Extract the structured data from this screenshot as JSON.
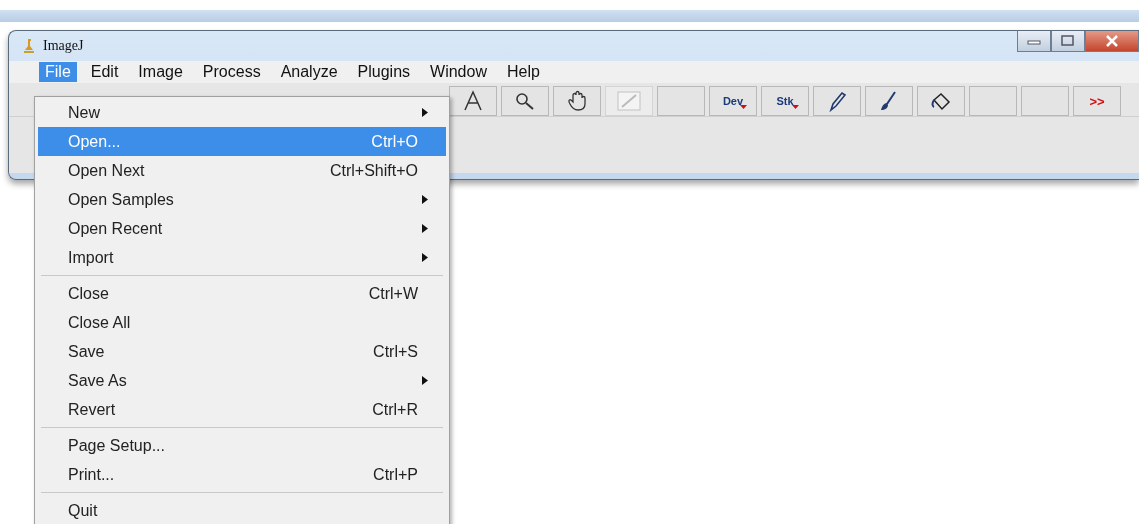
{
  "window": {
    "title": "ImageJ"
  },
  "menubar": [
    {
      "label": "File",
      "selected": true
    },
    {
      "label": "Edit",
      "selected": false
    },
    {
      "label": "Image",
      "selected": false
    },
    {
      "label": "Process",
      "selected": false
    },
    {
      "label": "Analyze",
      "selected": false
    },
    {
      "label": "Plugins",
      "selected": false
    },
    {
      "label": "Window",
      "selected": false
    },
    {
      "label": "Help",
      "selected": false
    }
  ],
  "toolbar": [
    {
      "kind": "text-tool",
      "disabled": false
    },
    {
      "kind": "magnifier",
      "disabled": false
    },
    {
      "kind": "hand",
      "disabled": false
    },
    {
      "kind": "arrow",
      "disabled": true
    },
    {
      "kind": "blank",
      "disabled": false
    },
    {
      "kind": "label",
      "label": "Dev",
      "dropdown": true,
      "disabled": false
    },
    {
      "kind": "label",
      "label": "Stk",
      "dropdown": true,
      "disabled": false
    },
    {
      "kind": "pencil",
      "disabled": false
    },
    {
      "kind": "brush",
      "disabled": false
    },
    {
      "kind": "fill",
      "disabled": false
    },
    {
      "kind": "blank",
      "disabled": false
    },
    {
      "kind": "blank",
      "disabled": false
    },
    {
      "kind": "more",
      "label": ">>",
      "disabled": false
    }
  ],
  "file_menu": [
    {
      "kind": "item",
      "label": "New",
      "submenu": true,
      "selected": false
    },
    {
      "kind": "item",
      "label": "Open...",
      "shortcut": "Ctrl+O",
      "selected": true
    },
    {
      "kind": "item",
      "label": "Open Next",
      "shortcut": "Ctrl+Shift+O",
      "selected": false
    },
    {
      "kind": "item",
      "label": "Open Samples",
      "submenu": true,
      "selected": false
    },
    {
      "kind": "item",
      "label": "Open Recent",
      "submenu": true,
      "selected": false
    },
    {
      "kind": "item",
      "label": "Import",
      "submenu": true,
      "selected": false
    },
    {
      "kind": "separator"
    },
    {
      "kind": "item",
      "label": "Close",
      "shortcut": "Ctrl+W",
      "selected": false
    },
    {
      "kind": "item",
      "label": "Close All",
      "selected": false
    },
    {
      "kind": "item",
      "label": "Save",
      "shortcut": "Ctrl+S",
      "selected": false
    },
    {
      "kind": "item",
      "label": "Save As",
      "submenu": true,
      "selected": false
    },
    {
      "kind": "item",
      "label": "Revert",
      "shortcut": "Ctrl+R",
      "selected": false
    },
    {
      "kind": "separator"
    },
    {
      "kind": "item",
      "label": "Page Setup...",
      "selected": false
    },
    {
      "kind": "item",
      "label": "Print...",
      "shortcut": "Ctrl+P",
      "selected": false
    },
    {
      "kind": "separator"
    },
    {
      "kind": "item",
      "label": "Quit",
      "selected": false
    }
  ]
}
